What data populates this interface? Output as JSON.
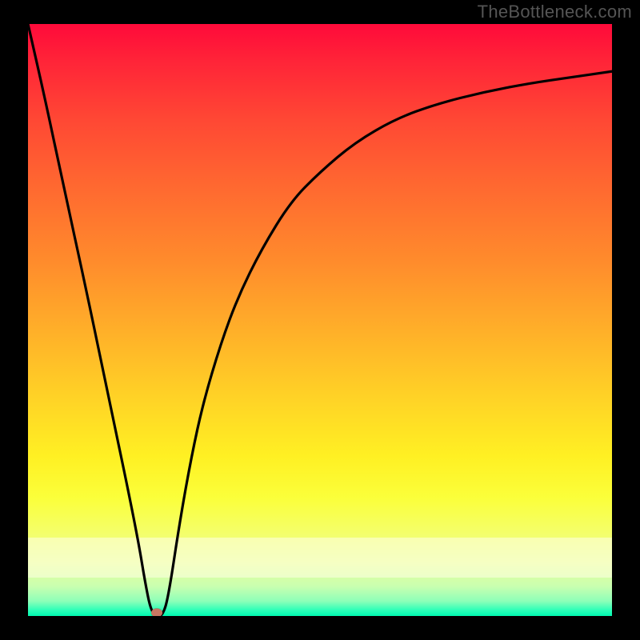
{
  "watermark": "TheBottleneck.com",
  "colors": {
    "background": "#000000",
    "curve_stroke": "#000000",
    "marker_fill": "#c77763",
    "gradient_top": "#ff0a3a",
    "gradient_bottom": "#00f7b0"
  },
  "chart_data": {
    "type": "line",
    "title": "",
    "xlabel": "",
    "ylabel": "",
    "xlim": [
      0,
      100
    ],
    "ylim": [
      0,
      100
    ],
    "grid": false,
    "legend": false,
    "series": [
      {
        "name": "bottleneck-curve",
        "x": [
          0,
          3,
          6,
          10,
          14,
          17,
          19,
          20,
          21,
          22,
          23,
          24,
          26,
          28,
          30,
          33,
          36,
          40,
          45,
          50,
          56,
          63,
          70,
          78,
          86,
          93,
          100
        ],
        "y": [
          100,
          87,
          73,
          55,
          36,
          22,
          12,
          6,
          1,
          0,
          0,
          3,
          16,
          27,
          36,
          46,
          54,
          62,
          70,
          75,
          80,
          84,
          86.5,
          88.5,
          90,
          91,
          92
        ]
      }
    ],
    "annotations": [
      {
        "name": "min-marker",
        "x": 22,
        "y": 0.5
      }
    ],
    "background_gradient": {
      "direction": "top-to-bottom",
      "stops": [
        {
          "pos": 0.0,
          "color": "#ff0a3a"
        },
        {
          "pos": 0.28,
          "color": "#ff6a30"
        },
        {
          "pos": 0.52,
          "color": "#ffb029"
        },
        {
          "pos": 0.73,
          "color": "#fff023"
        },
        {
          "pos": 0.91,
          "color": "#e9ff9a"
        },
        {
          "pos": 1.0,
          "color": "#00f7b0"
        }
      ]
    }
  }
}
